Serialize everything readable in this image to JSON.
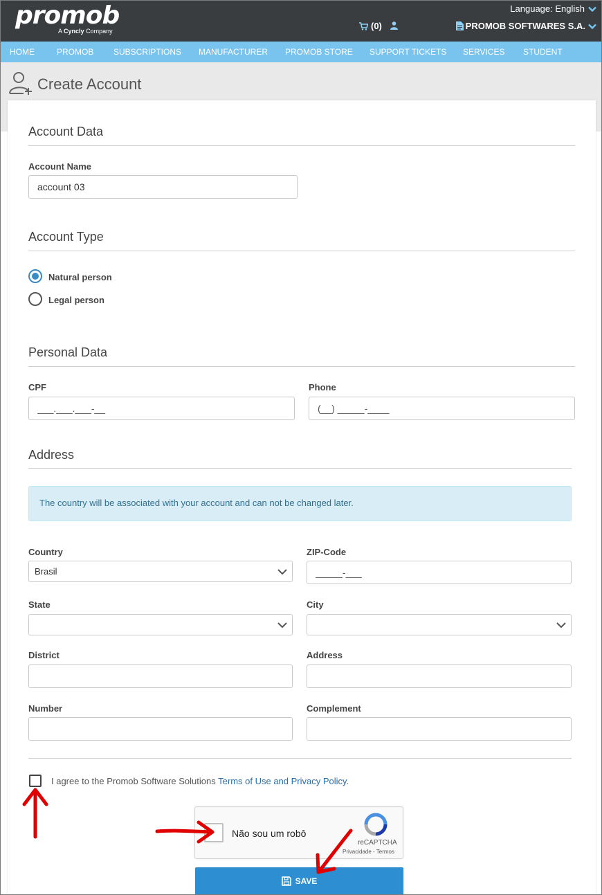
{
  "header": {
    "logo_text": "promob",
    "logo_sub_prefix": "A",
    "logo_sub_brand": "Cyncly",
    "logo_sub_suffix": "Company",
    "language_label": "Language: English",
    "cart_count": "(0)",
    "company": "PROMOB SOFTWARES S.A."
  },
  "nav": {
    "items": [
      "HOME",
      "PROMOB",
      "SUBSCRIPTIONS",
      "MANUFACTURER",
      "PROMOB STORE",
      "SUPPORT TICKETS",
      "SERVICES",
      "STUDENT"
    ]
  },
  "page": {
    "title": "Create Account"
  },
  "account_data": {
    "section_title": "Account Data",
    "name_label": "Account Name",
    "name_value": "account 03"
  },
  "account_type": {
    "section_title": "Account Type",
    "natural_label": "Natural person",
    "legal_label": "Legal person",
    "selected": "Natural person"
  },
  "personal_data": {
    "section_title": "Personal Data",
    "cpf_label": "CPF",
    "cpf_placeholder": "___.___.___-__",
    "phone_label": "Phone",
    "phone_placeholder": "(__) _____-____"
  },
  "address": {
    "section_title": "Address",
    "alert": "The country will be associated with your account and can not be changed later.",
    "country_label": "Country",
    "country_value": "Brasil",
    "zip_label": "ZIP-Code",
    "zip_placeholder": "_____-___",
    "state_label": "State",
    "state_value": "",
    "city_label": "City",
    "city_value": "",
    "district_label": "District",
    "address_label": "Address",
    "number_label": "Number",
    "complement_label": "Complement"
  },
  "terms": {
    "prefix": "I agree to the Promob Software Solutions",
    "link": "Terms of Use and Privacy Policy",
    "suffix": "."
  },
  "captcha": {
    "text": "Não sou um robô",
    "brand": "reCAPTCHA",
    "links": "Privacidade - Termos"
  },
  "save_label": "SAVE",
  "colors": {
    "topbar": "#3a3d40",
    "nav": "#79c3ef",
    "accent": "#2d8fd1",
    "annotation_arrow": "#e00000"
  }
}
